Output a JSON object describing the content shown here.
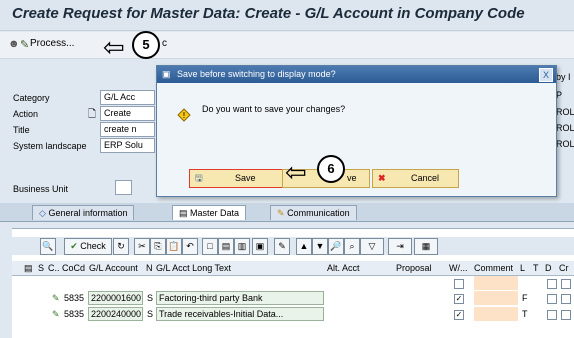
{
  "window": {
    "title": "Create Request for Master Data: Create - G/L Account in Company Code"
  },
  "toolbar": {
    "process_label": "Process...",
    "trailing_char": "c"
  },
  "callouts": {
    "one": "5",
    "two": "6"
  },
  "form": {
    "category": {
      "label": "Category",
      "value": "G/L Acc"
    },
    "action": {
      "label": "Action",
      "value": "Create"
    },
    "title": {
      "label": "Title",
      "value": "create n"
    },
    "system_landscape": {
      "label": "System landscape",
      "value": "ERP Solu"
    },
    "business_unit": {
      "label": "Business Unit"
    },
    "right_fragments": [
      "by I",
      "P",
      "ROLI",
      "ROLI",
      "ROLI"
    ]
  },
  "tabs": [
    {
      "label": "General information"
    },
    {
      "label": "Master Data"
    },
    {
      "label": "Communication"
    }
  ],
  "grid": {
    "check_label": "Check",
    "headers": [
      "S",
      "C..",
      "CoCd",
      "G/L Account",
      "N",
      "G/L Acct Long Text",
      "Alt. Acct",
      "Proposal",
      "W/...",
      "Comment",
      "L",
      "T",
      "D",
      "Cr"
    ],
    "rows": [
      {
        "cocd": "5835",
        "gl_account": "2200001600",
        "n": "S",
        "long_text": "Factoring-third party Bank",
        "w": "✓",
        "l": "F"
      },
      {
        "cocd": "5835",
        "gl_account": "2200240000",
        "n": "S",
        "long_text": "Trade receivables-Initial Data...",
        "w": "✓",
        "l": "T"
      }
    ]
  },
  "dialog": {
    "title": "Save before switching to display mode?",
    "message": "Do you want to save your changes?",
    "save_label": "Save",
    "fragment_label": "ve",
    "cancel_label": "Cancel",
    "close_label": "X"
  }
}
